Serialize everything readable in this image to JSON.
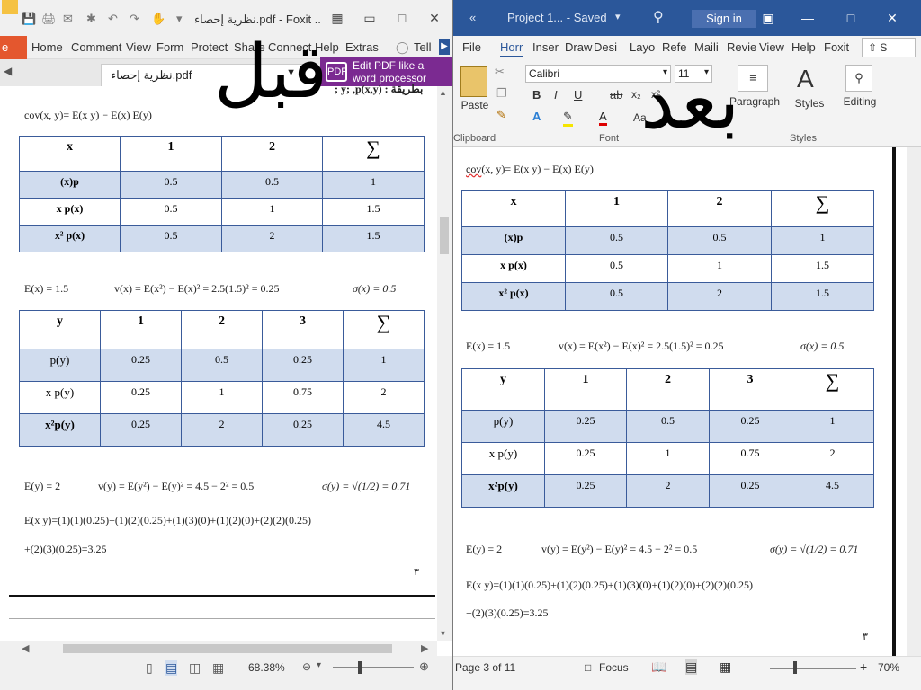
{
  "foxit": {
    "title": "نظرية إحصاء.pdf - Foxit ...",
    "menu": [
      "Home",
      "Comment",
      "View",
      "Form",
      "Protect",
      "Share",
      "Connect",
      "Help",
      "Extras"
    ],
    "file_label": "e",
    "tell": "Tell",
    "tab_label": "نظرية إحصاء.pdf",
    "ad_line1": "Edit PDF like a",
    "ad_line2": "word processor",
    "top_text": "; y; ,p(x,y) : بطريقة",
    "zoom": "68.38%",
    "page_mark": "٣"
  },
  "word": {
    "back_arrows": "«",
    "doc_title": "Project 1... - Saved",
    "sign_in": "Sign in",
    "tabs": [
      "File",
      "Horr",
      "Inser",
      "Draw",
      "Desi",
      "Layo",
      "Refe",
      "Maili",
      "Revie",
      "View",
      "Help",
      "Foxit"
    ],
    "share": "S",
    "font_name": "Calibri",
    "font_size": "11",
    "paste": "Paste",
    "clipboard": "Clipboard",
    "font_group": "Font",
    "paragraph": "Paragraph",
    "styles": "Styles",
    "styles_group": "Styles",
    "editing": "Editing",
    "page_status": "Page 3 of 11",
    "focus": "Focus",
    "zoom": "70%"
  },
  "overlay": {
    "before": "قبل",
    "after": "بعد"
  },
  "content": {
    "cov": "cov(x, y)= E(x y) − E(x) E(y)",
    "table_x": {
      "header": [
        "x",
        "1",
        "2",
        "∑"
      ],
      "rows": [
        [
          "(x)p",
          "0.5",
          "0.5",
          "1"
        ],
        [
          "x p(x)",
          "0.5",
          "1",
          "1.5"
        ],
        [
          "x² p(x)",
          "0.5",
          "2",
          "1.5"
        ]
      ]
    },
    "ex": "E(x) = 1.5",
    "vx": "v(x) = E(x²) − E(x)² = 2.5(1.5)² = 0.25",
    "sx": "σ(x) = 0.5",
    "table_y": {
      "header": [
        "y",
        "1",
        "2",
        "3",
        "∑"
      ],
      "rows": [
        [
          "p(y)",
          "0.25",
          "0.5",
          "0.25",
          "1"
        ],
        [
          "x p(y)",
          "0.25",
          "1",
          "0.75",
          "2"
        ],
        [
          "x²p(y)",
          "0.25",
          "2",
          "0.25",
          "4.5"
        ]
      ]
    },
    "ey": "E(y) = 2",
    "vy": "v(y) = E(y²) − E(y)² = 4.5 − 2² = 0.5",
    "sy": "σ(y) = √(1/2) = 0.71",
    "exy1": "E(x y)=(1)(1)(0.25)+(1)(2)(0.25)+(1)(3)(0)+(1)(2)(0)+(2)(2)(0.25)",
    "exy2": "+(2)(3)(0.25)=3.25"
  }
}
